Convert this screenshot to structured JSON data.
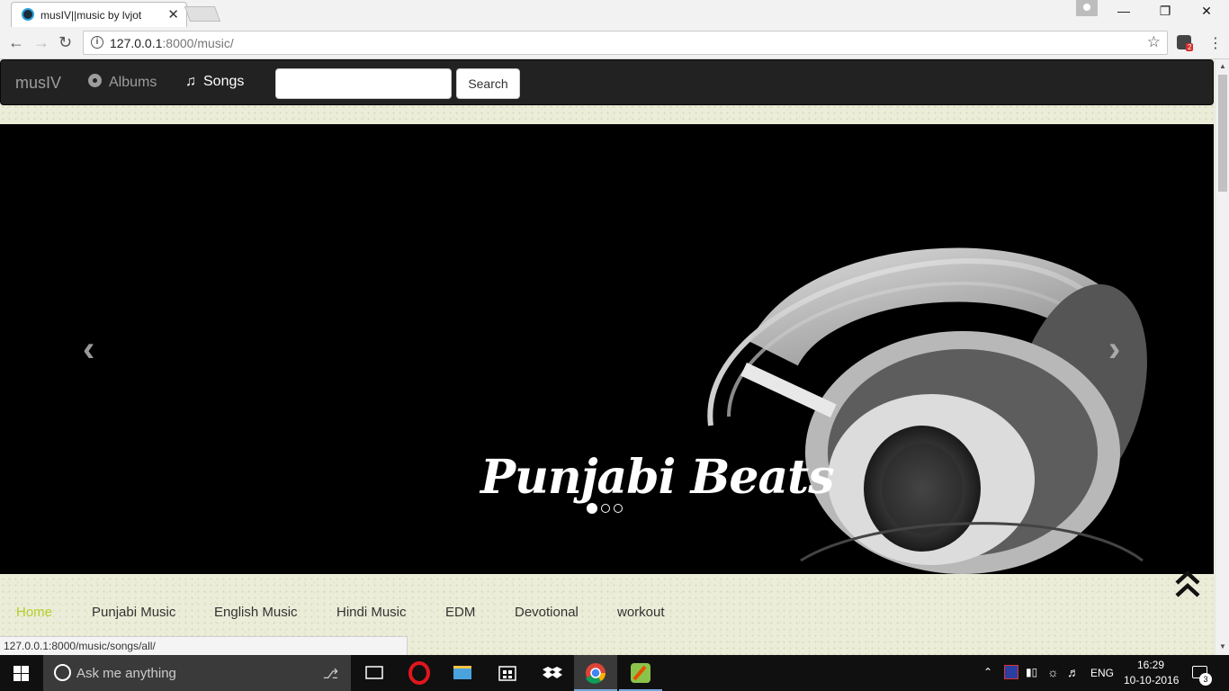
{
  "browser": {
    "tab_title": "musIV||music by lvjot",
    "tab_close": "✕",
    "url_host": "127.0.0.1",
    "url_rest": ":8000/music/",
    "status_url": "127.0.0.1:8000/music/songs/all/",
    "extension_badge": "2"
  },
  "navbar": {
    "brand": "musIV",
    "albums": "Albums",
    "songs": "Songs",
    "search_value": "",
    "search_button": "Search"
  },
  "carousel": {
    "caption": "Punjabi Beats",
    "slide_count": 3,
    "active_slide": 1
  },
  "subnav": {
    "items": [
      "Home",
      "Punjabi Music",
      "English Music",
      "Hindi Music",
      "EDM",
      "Devotional",
      "workout"
    ]
  },
  "taskbar": {
    "search_placeholder": "Ask me anything",
    "language": "ENG",
    "time": "16:29",
    "date": "10-10-2016",
    "notification_count": "3"
  },
  "colors": {
    "navbar_bg": "#222222",
    "subnav_active": "#b5cf2a",
    "taskbar_bg": "#101010"
  }
}
